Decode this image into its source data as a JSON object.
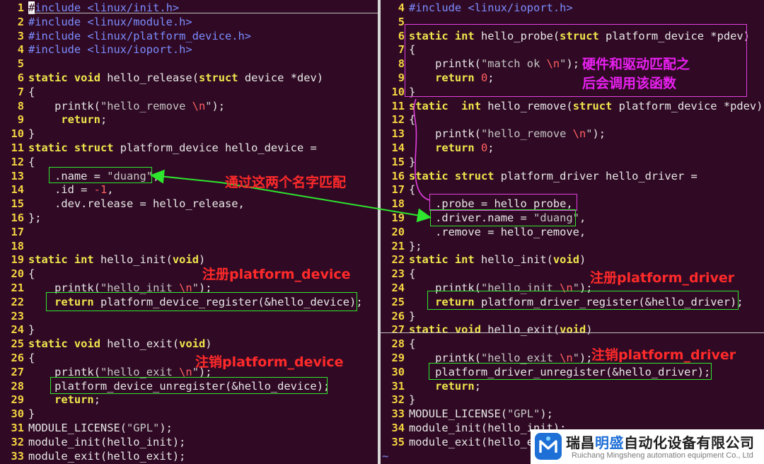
{
  "left_pane": {
    "lines": [
      {
        "n": "1",
        "code": "#include <linux/init.h>"
      },
      {
        "n": "2",
        "code": "#include <linux/module.h>"
      },
      {
        "n": "3",
        "code": "#include <linux/platform_device.h>"
      },
      {
        "n": "4",
        "code": "#include <linux/ioport.h>"
      },
      {
        "n": "5",
        "code": ""
      },
      {
        "n": "6",
        "code": "static void hello_release(struct device *dev)"
      },
      {
        "n": "7",
        "code": "{"
      },
      {
        "n": "8",
        "code": "    printk(\"hello_remove \\n\");"
      },
      {
        "n": "9",
        "code": "     return;"
      },
      {
        "n": "10",
        "code": "}"
      },
      {
        "n": "11",
        "code": "static struct platform_device hello_device ="
      },
      {
        "n": "12",
        "code": "{"
      },
      {
        "n": "13",
        "code": "    .name = \"duang\","
      },
      {
        "n": "14",
        "code": "    .id = -1,"
      },
      {
        "n": "15",
        "code": "    .dev.release = hello_release,"
      },
      {
        "n": "16",
        "code": "};"
      },
      {
        "n": "17",
        "code": ""
      },
      {
        "n": "18",
        "code": ""
      },
      {
        "n": "19",
        "code": "static int hello_init(void)"
      },
      {
        "n": "20",
        "code": "{"
      },
      {
        "n": "21",
        "code": "    printk(\"hello_init \\n\");"
      },
      {
        "n": "22",
        "code": "    return platform_device_register(&hello_device);"
      },
      {
        "n": "23",
        "code": ""
      },
      {
        "n": "24",
        "code": "}"
      },
      {
        "n": "25",
        "code": "static void hello_exit(void)"
      },
      {
        "n": "26",
        "code": "{"
      },
      {
        "n": "27",
        "code": "    printk(\"hello_exit \\n\");"
      },
      {
        "n": "28",
        "code": "    platform_device_unregister(&hello_device);"
      },
      {
        "n": "29",
        "code": "    return;"
      },
      {
        "n": "30",
        "code": "}"
      },
      {
        "n": "31",
        "code": "MODULE_LICENSE(\"GPL\");"
      },
      {
        "n": "32",
        "code": "module_init(hello_init);"
      },
      {
        "n": "33",
        "code": "module_exit(hello_exit);"
      }
    ]
  },
  "right_pane": {
    "lines": [
      {
        "n": "4",
        "code": "#include <linux/ioport.h>"
      },
      {
        "n": "5",
        "code": ""
      },
      {
        "n": "6",
        "code": "static int hello_probe(struct platform_device *pdev)"
      },
      {
        "n": "7",
        "code": "{"
      },
      {
        "n": "8",
        "code": "    printk(\"match ok \\n\");"
      },
      {
        "n": "9",
        "code": "    return 0;"
      },
      {
        "n": "10",
        "code": "}"
      },
      {
        "n": "11",
        "code": "static  int hello_remove(struct platform_device *pdev)"
      },
      {
        "n": "12",
        "code": "{"
      },
      {
        "n": "13",
        "code": "    printk(\"hello_remove \\n\");"
      },
      {
        "n": "14",
        "code": "    return 0;"
      },
      {
        "n": "15",
        "code": "}"
      },
      {
        "n": "16",
        "code": "static struct platform_driver hello_driver ="
      },
      {
        "n": "17",
        "code": "{"
      },
      {
        "n": "18",
        "code": "    .probe = hello_probe,"
      },
      {
        "n": "19",
        "code": "    .driver.name = \"duang\","
      },
      {
        "n": "20",
        "code": "    .remove = hello_remove,"
      },
      {
        "n": "21",
        "code": "};"
      },
      {
        "n": "22",
        "code": "static int hello_init(void)"
      },
      {
        "n": "23",
        "code": "{"
      },
      {
        "n": "24",
        "code": "    printk(\"hello_init \\n\");"
      },
      {
        "n": "25",
        "code": "    return platform_driver_register(&hello_driver);"
      },
      {
        "n": "26",
        "code": "}"
      },
      {
        "n": "27",
        "code": "static void hello_exit(void)"
      },
      {
        "n": "28",
        "code": "{"
      },
      {
        "n": "29",
        "code": "    printk(\"hello_exit \\n\");"
      },
      {
        "n": "30",
        "code": "    platform_driver_unregister(&hello_driver);"
      },
      {
        "n": "31",
        "code": "    return;"
      },
      {
        "n": "32",
        "code": "}"
      },
      {
        "n": "33",
        "code": "MODULE_LICENSE(\"GPL\");"
      },
      {
        "n": "34",
        "code": "module_init(hello_init);"
      },
      {
        "n": "35",
        "code": "module_exit(hello_exit);"
      }
    ],
    "tilde": "~"
  },
  "annotations": {
    "match_names": "通过这两个名字匹配",
    "probe_note": "硬件和驱动匹配之\n后会调用该函数",
    "register_device": "注册platform_device",
    "unregister_device": "注销platform_device",
    "register_driver": "注册platform_driver",
    "unregister_driver": "注销platform_driver"
  },
  "logo": {
    "name_prefix": "瑞昌",
    "name_highlight": "明盛",
    "name_suffix": "自动化设备有限公司",
    "name_en": "Ruichang Mingsheng automation equipment Co., Ltd"
  },
  "colors": {
    "background": "#300a24",
    "line_number": "#f5d542",
    "keyword": "#f0e74d",
    "preprocessor": "#7b8cff",
    "escape": "#ff6060",
    "box_green": "#2ee62e",
    "box_magenta": "#e040e0",
    "annotation_red": "#ff2a2a",
    "annotation_magenta": "#e820f0",
    "logo_blue": "#1e6fd6"
  }
}
